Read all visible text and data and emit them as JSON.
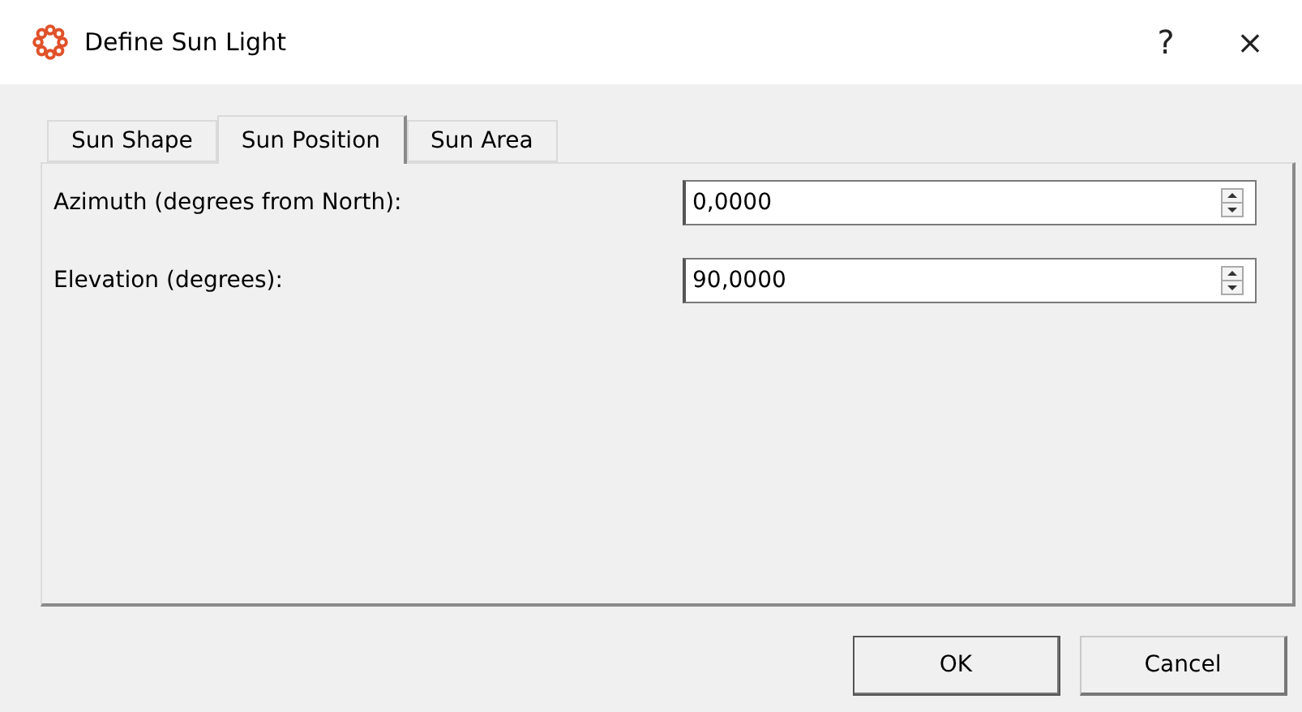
{
  "window": {
    "title": "Define Sun Light",
    "help": "?",
    "close": "×"
  },
  "tabs": [
    {
      "label": "Sun Shape",
      "selected": false
    },
    {
      "label": "Sun Position",
      "selected": true
    },
    {
      "label": "Sun Area",
      "selected": false
    }
  ],
  "fields": [
    {
      "label": "Azimuth (degrees from North):",
      "value": "0,0000"
    },
    {
      "label": "Elevation (degrees):",
      "value": "90,0000"
    }
  ],
  "buttons": [
    {
      "label": "OK",
      "default": true
    },
    {
      "label": "Cancel",
      "default": false
    }
  ]
}
